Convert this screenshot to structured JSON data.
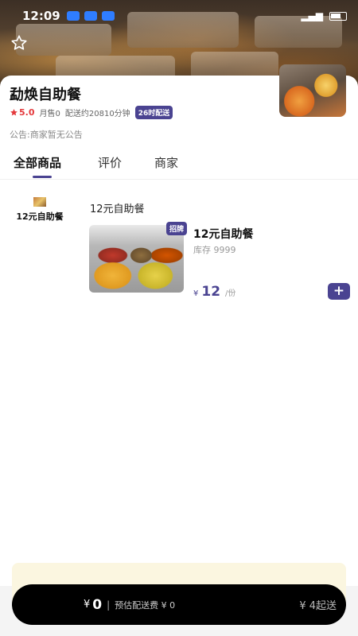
{
  "status_bar": {
    "time": "12:09"
  },
  "store": {
    "name": "勐焕自助餐",
    "rating": "5.0",
    "monthly_sales": "月售0",
    "delivery_time": "配送约20810分钟",
    "hours_badge": "26时配送",
    "notice": "公告:商家暂无公告"
  },
  "tabs": [
    {
      "label": "全部商品",
      "active": true
    },
    {
      "label": "评价",
      "active": false
    },
    {
      "label": "商家",
      "active": false
    }
  ],
  "categories": [
    {
      "label": "12元自助餐",
      "selected": true
    }
  ],
  "section": {
    "title": "12元自助餐"
  },
  "product": {
    "tag": "招牌",
    "name": "12元自助餐",
    "stock": "库存 9999",
    "currency": "¥",
    "price": "12",
    "unit": "/份",
    "add_label": "+"
  },
  "cart": {
    "currency": "¥",
    "total": "0",
    "separator": "|",
    "delivery_fee": "预估配送费 ¥ 0",
    "min_order": "¥ 4起送"
  },
  "colors": {
    "accent": "#4a4391",
    "rating": "#e4393c",
    "cart_bar": "#000000",
    "tip_panel": "#fbf6e0"
  },
  "icons": {
    "favorite": "star-outline-icon",
    "rating": "star-icon",
    "add": "plus-icon"
  }
}
